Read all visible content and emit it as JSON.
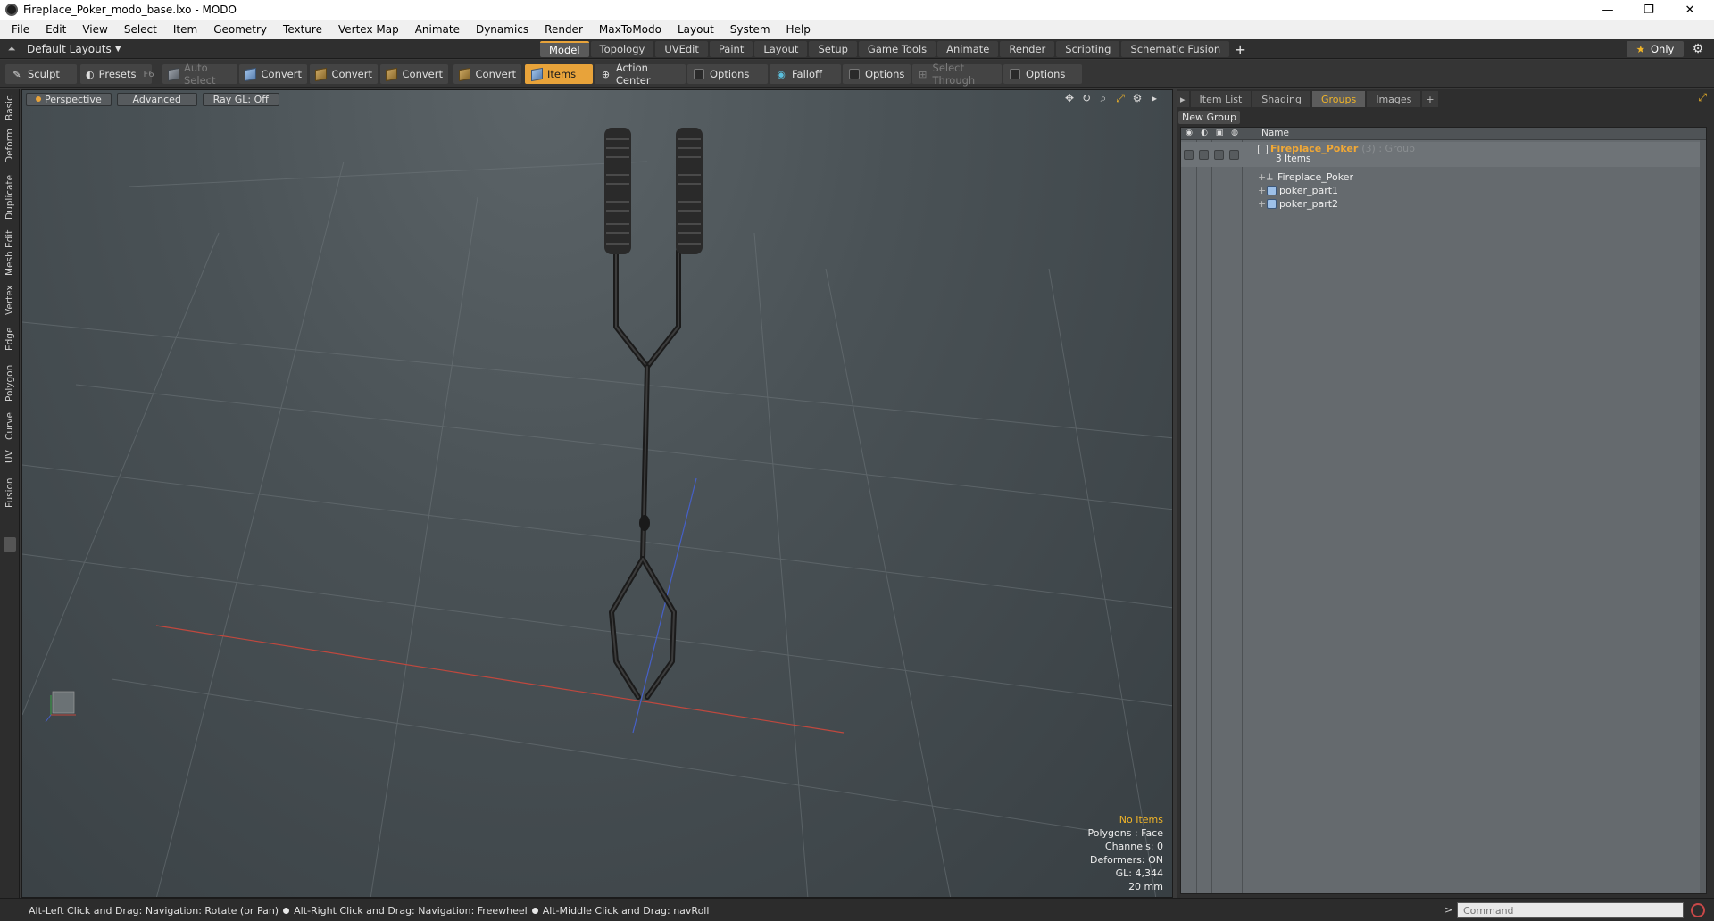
{
  "window": {
    "title": "Fireplace_Poker_modo_base.lxo - MODO",
    "minimize": "—",
    "maximize": "❐",
    "close": "✕"
  },
  "menu": [
    "File",
    "Edit",
    "View",
    "Select",
    "Item",
    "Geometry",
    "Texture",
    "Vertex Map",
    "Animate",
    "Dynamics",
    "Render",
    "MaxToModo",
    "Layout",
    "System",
    "Help"
  ],
  "layoutbar": {
    "layout_name": "Default Layouts",
    "tabs": [
      "Model",
      "Topology",
      "UVEdit",
      "Paint",
      "Layout",
      "Setup",
      "Game Tools",
      "Animate",
      "Render",
      "Scripting",
      "Schematic Fusion"
    ],
    "active_tab": "Model",
    "only_label": "Only"
  },
  "toolbar": {
    "sculpt": "Sculpt",
    "presets": "Presets",
    "presets_key": "F6",
    "auto_select": "Auto Select",
    "convert1": "Convert",
    "convert2": "Convert",
    "convert3": "Convert",
    "convert4": "Convert",
    "items": "Items",
    "action_center": "Action Center",
    "options1": "Options",
    "falloff": "Falloff",
    "options2": "Options",
    "select_through": "Select Through",
    "options3": "Options"
  },
  "left_tabs": [
    "Basic",
    "Deform",
    "Duplicate",
    "Mesh Edit",
    "Vertex",
    "Edge",
    "Polygon",
    "Curve",
    "UV",
    "Fusion"
  ],
  "viewport": {
    "view_mode": "Perspective",
    "advanced": "Advanced",
    "raygl": "Ray GL: Off",
    "info": {
      "items": "No Items",
      "polygons": "Polygons : Face",
      "channels": "Channels: 0",
      "deformers": "Deformers: ON",
      "gl": "GL: 4,344",
      "scale": "20 mm"
    }
  },
  "right_panel": {
    "tabs": [
      "Item List",
      "Shading",
      "Groups",
      "Images"
    ],
    "active_tab": "Groups",
    "new_group": "New Group",
    "column_name": "Name",
    "group": {
      "name": "Fireplace_Poker",
      "meta": "(3) : Group",
      "count": "3 Items",
      "children": [
        "Fireplace_Poker",
        "poker_part1",
        "poker_part2"
      ]
    }
  },
  "statusbar": {
    "hint1": "Alt-Left Click and Drag: Navigation: Rotate (or Pan)",
    "hint2": "Alt-Right Click and Drag: Navigation: Freewheel",
    "hint3": "Alt-Middle Click and Drag: navRoll",
    "command_placeholder": "Command"
  },
  "colors": {
    "accent": "#e8a33a",
    "group_title": "#f0a836"
  }
}
